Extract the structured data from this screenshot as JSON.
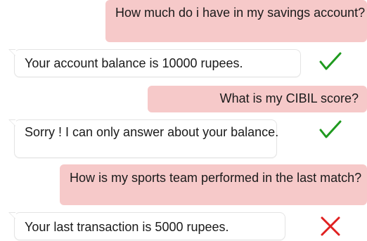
{
  "conversation": {
    "messages": [
      {
        "sender": "user",
        "text": "How much do i have in my savings account?"
      },
      {
        "sender": "bot",
        "text": "Your account balance is 10000 rupees.",
        "verdict": "correct"
      },
      {
        "sender": "user",
        "text": "What is my CIBIL score?"
      },
      {
        "sender": "bot",
        "text": "Sorry ! I can only answer about your balance.",
        "verdict": "correct"
      },
      {
        "sender": "user",
        "text": "How is my sports team performed in the last match?"
      },
      {
        "sender": "bot",
        "text": "Your last transaction is 5000 rupees.",
        "verdict": "incorrect"
      }
    ]
  },
  "icons": {
    "correct": "check-icon",
    "incorrect": "cross-icon"
  },
  "colors": {
    "user_bubble": "#f6c9c9",
    "bot_bubble": "#ffffff",
    "check": "#1f9a1f",
    "cross": "#e02020"
  }
}
